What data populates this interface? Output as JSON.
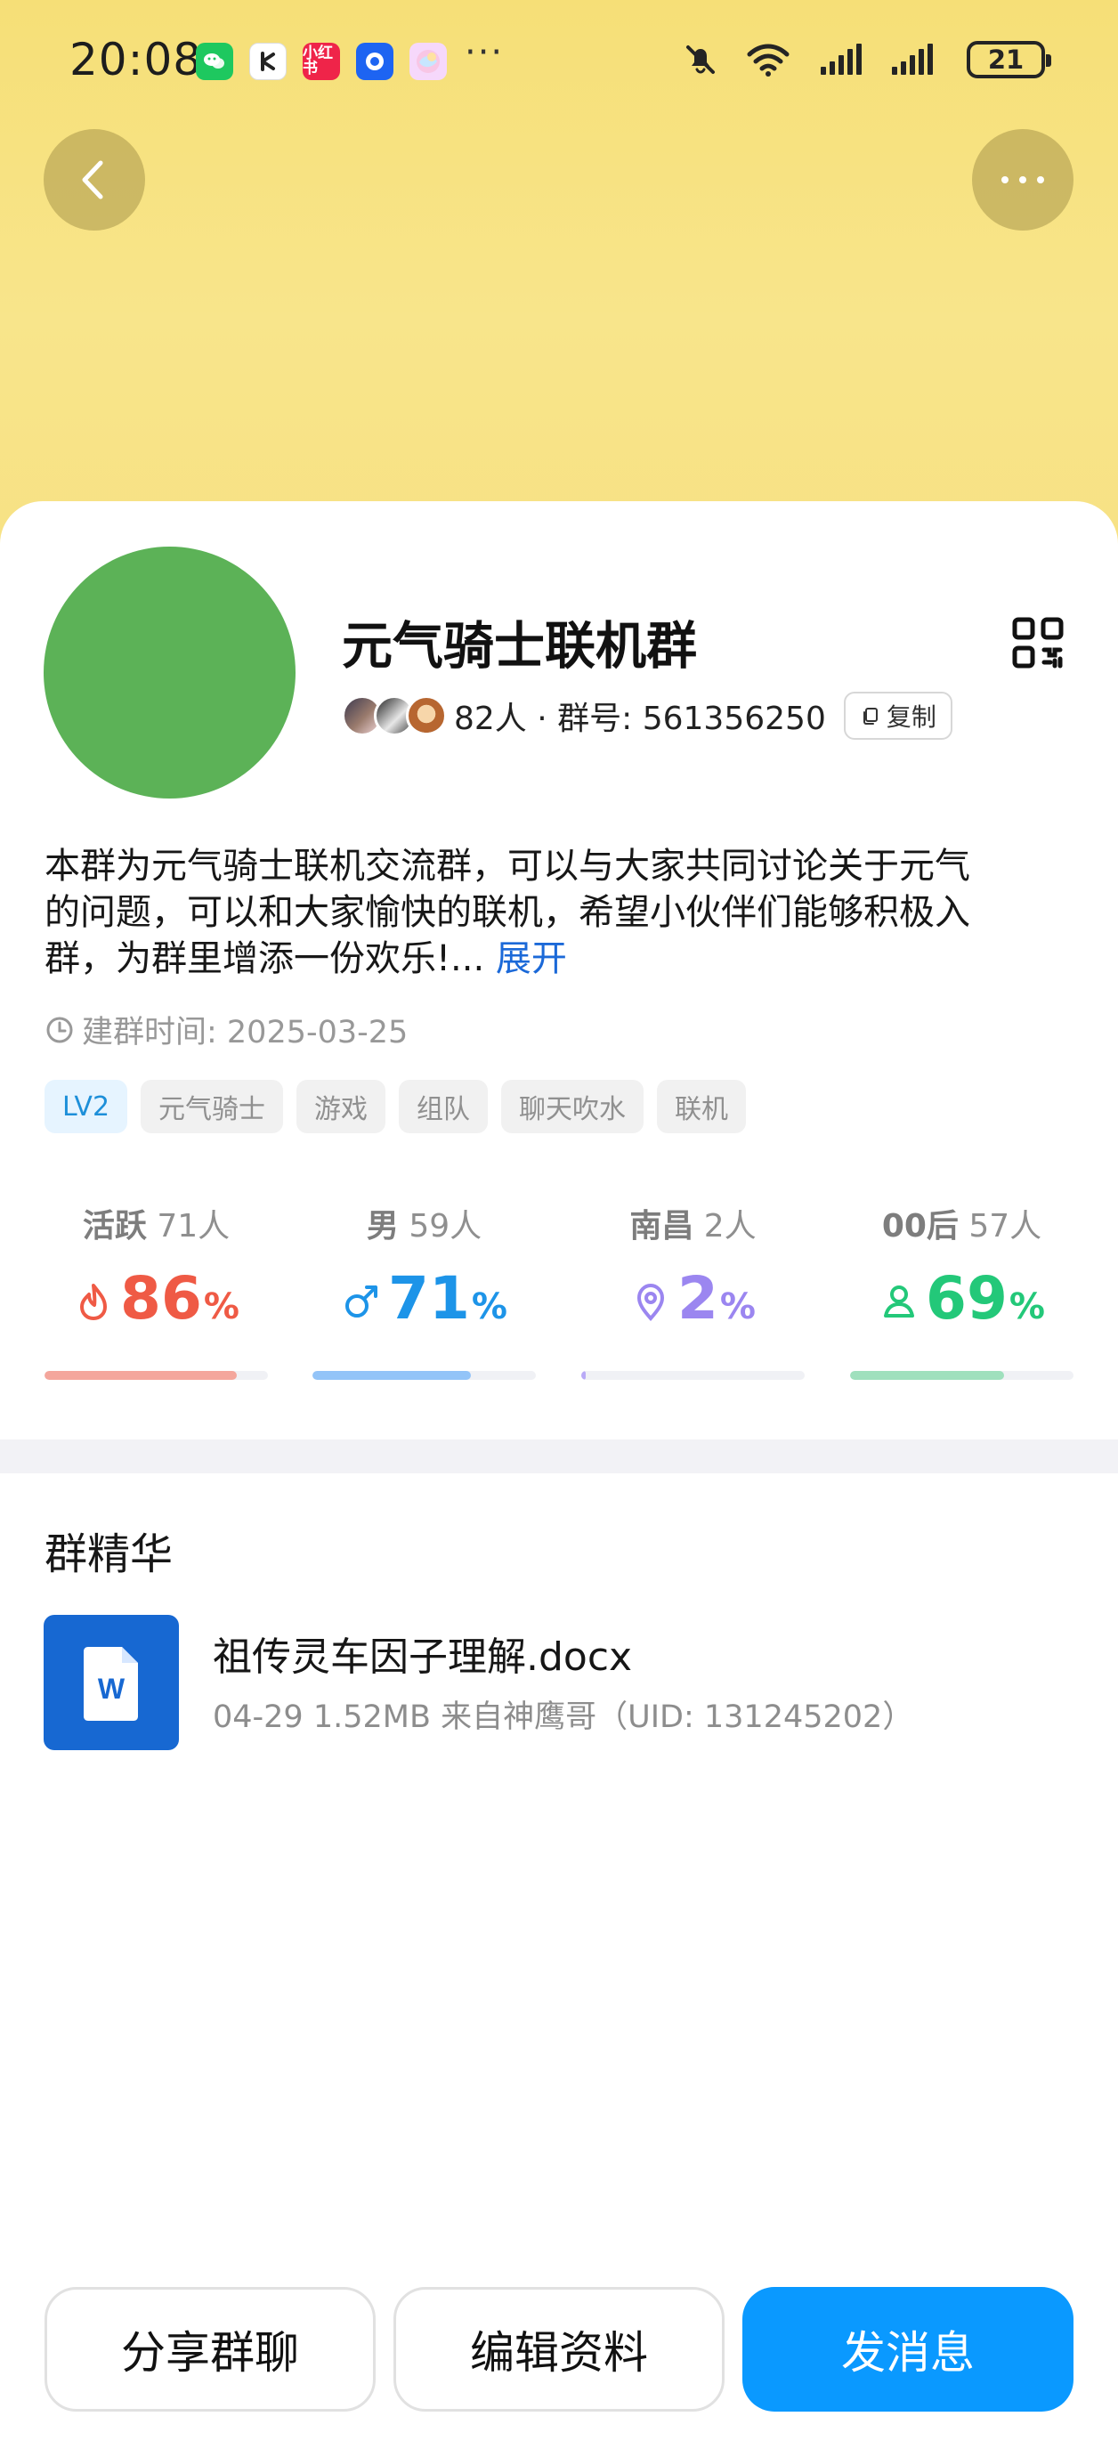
{
  "status_bar": {
    "time": "20:08",
    "app_icons": [
      {
        "name": "wechat-icon",
        "label": "",
        "color": "#1ec85f"
      },
      {
        "name": "app-icon-k",
        "label": "",
        "color": "#ffffff"
      },
      {
        "name": "xiaohongshu-icon",
        "label": "小红书",
        "color": "#ef2449"
      },
      {
        "name": "blue-circle-app-icon",
        "label": "",
        "color": "#1d64f2"
      },
      {
        "name": "color-orb-app-icon",
        "label": "",
        "color": "#f6d8fb"
      }
    ],
    "more_indicator": "···",
    "battery_level": "21"
  },
  "header": {
    "back_icon": "chevron-left-icon",
    "more_icon": "ellipsis-icon",
    "hero_color": "#f7e287"
  },
  "group": {
    "name": "元气骑士联机群",
    "avatar_color": "#5cb257",
    "member_text": "82人 · 群号: 561356250",
    "copy_label": "复制",
    "description": "本群为元气骑士联机交流群，可以与大家共同讨论关于元气\n的问题，可以和大家愉快的联机，希望小伙伴们能够积极入\n群，为群里增添一份欢乐!... ",
    "expand_label": "展开",
    "created_text": "建群时间: 2025-03-25",
    "tags": [
      "LV2",
      "元气骑士",
      "游戏",
      "组队",
      "聊天吹水",
      "联机"
    ]
  },
  "stats": [
    {
      "name": "活跃",
      "count": "71人",
      "percent": 86,
      "percent_text": "86",
      "unit": "%",
      "color": "#ef5a45",
      "bar_color": "#f4a69c",
      "icon": "flame-icon"
    },
    {
      "name": "男",
      "count": "59人",
      "percent": 71,
      "percent_text": "71",
      "unit": "%",
      "color": "#1d94e8",
      "bar_color": "#93c4f8",
      "icon": "male-icon"
    },
    {
      "name": "南昌",
      "count": "2人",
      "percent": 2,
      "percent_text": "2",
      "unit": "%",
      "color": "#9b86f0",
      "bar_color": "#b9aaf7",
      "icon": "location-pin-icon"
    },
    {
      "name": "00后",
      "count": "57人",
      "percent": 69,
      "percent_text": "69",
      "unit": "%",
      "color": "#23c879",
      "bar_color": "#9fe0bd",
      "icon": "person-icon"
    }
  ],
  "essence": {
    "title": "群精华",
    "file": {
      "icon": "word-document-icon",
      "icon_letter": "W",
      "name": "祖传灵车因子理解.docx",
      "meta": "04-29  1.52MB  来自神鹰哥（UID: 131245202）"
    }
  },
  "actions": {
    "share": "分享群聊",
    "edit": "编辑资料",
    "message": "发消息"
  }
}
